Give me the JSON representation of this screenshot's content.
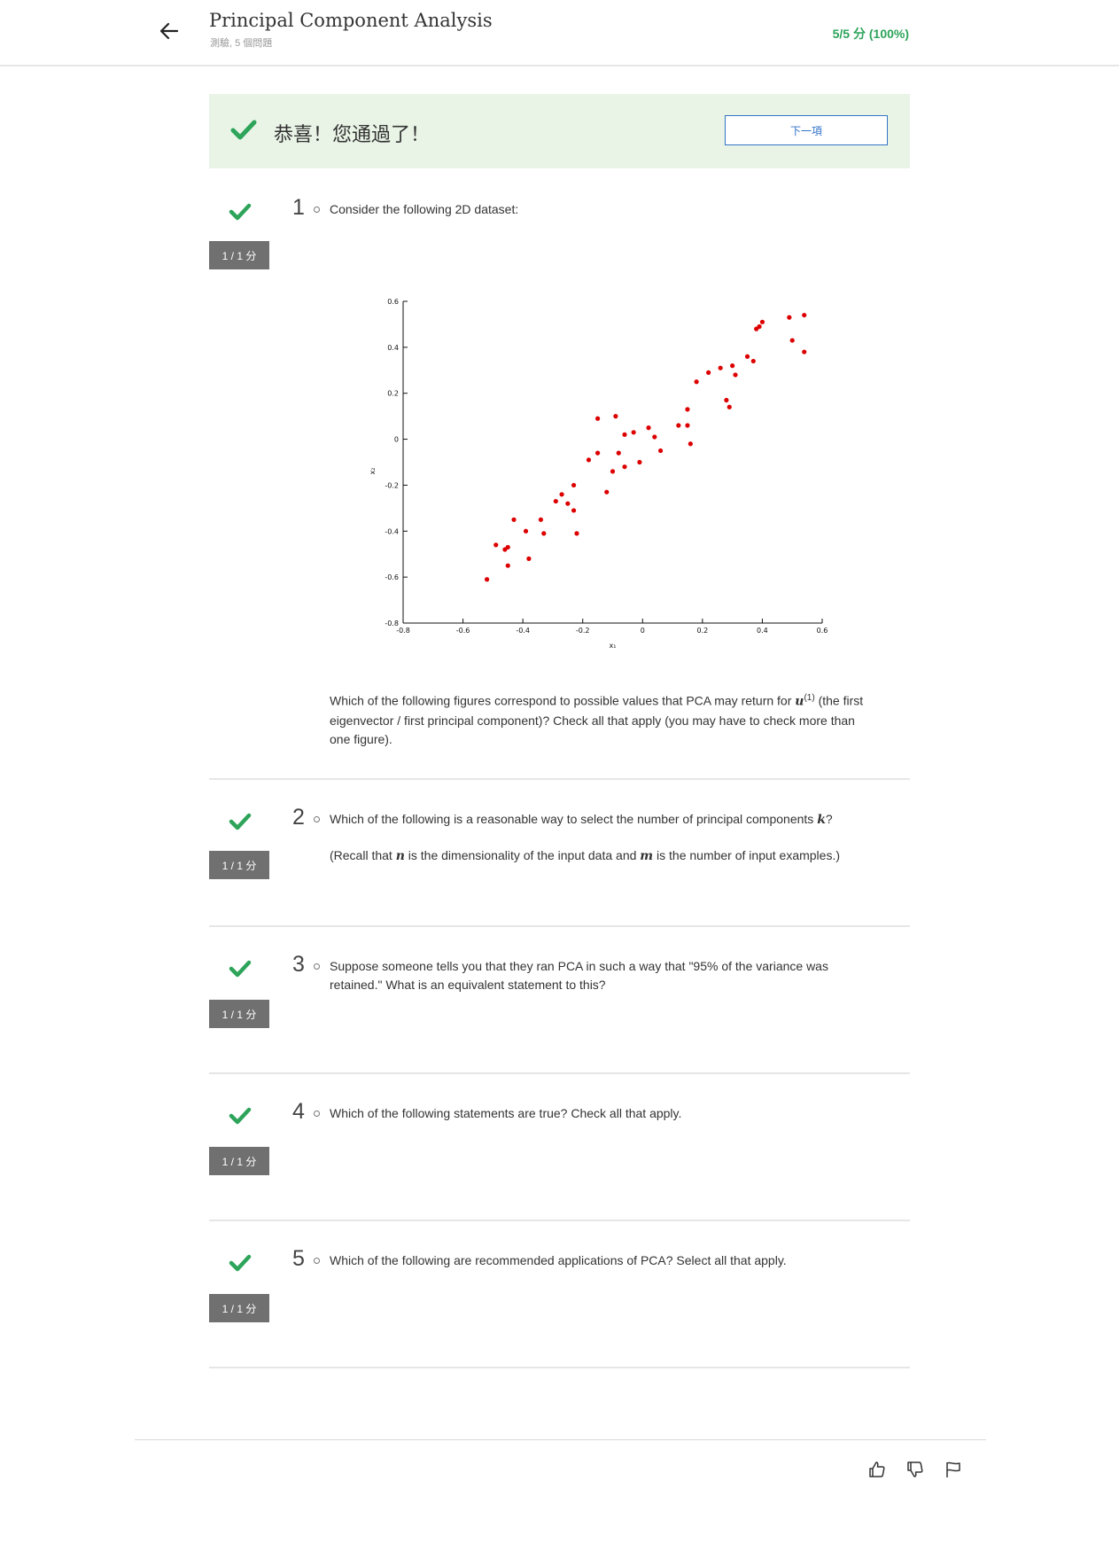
{
  "header": {
    "title": "Principal Component Analysis",
    "subtitle": "測驗, 5 個問題",
    "score": "5/5 分 (100%)"
  },
  "banner": {
    "message": "恭喜！您通過了！",
    "next_label": "下一項"
  },
  "questions": [
    {
      "number": "1",
      "badge": "1 / 1 分",
      "text": "Consider the following 2D dataset:",
      "followup_a": "Which of the following figures correspond to possible values that PCA may return for",
      "followup_math": "u",
      "followup_sup": "(1)",
      "followup_b": "(the first eigenvector / first principal component)? Check all that apply (you may have to check more than one figure)."
    },
    {
      "number": "2",
      "badge": "1 / 1 分",
      "text_a": "Which of the following is a reasonable way to select the number of principal components",
      "text_math": "k",
      "text_b": "?",
      "recall_a": "(Recall that",
      "recall_n": "n",
      "recall_b": "is the dimensionality of the input data and",
      "recall_m": "m",
      "recall_c": "is the number of input examples.)"
    },
    {
      "number": "3",
      "badge": "1 / 1 分",
      "text": "Suppose someone tells you that they ran PCA in such a way that \"95% of the variance was retained.\" What is an equivalent statement to this?"
    },
    {
      "number": "4",
      "badge": "1 / 1 分",
      "text": "Which of the following statements are true? Check all that apply."
    },
    {
      "number": "5",
      "badge": "1 / 1 分",
      "text": "Which of the following are recommended applications of PCA? Select all that apply."
    }
  ],
  "colors": {
    "accent_green": "#2da45a",
    "banner_bg": "#e9f4e6",
    "link_blue": "#3273c6",
    "point_red": "#dd0000"
  },
  "icons": [
    "back-arrow-icon",
    "checkmark-icon",
    "thumbs-up-icon",
    "thumbs-down-icon",
    "flag-icon"
  ],
  "chart_data": {
    "type": "scatter",
    "xlabel": "x₁",
    "ylabel": "x₂",
    "xlim": [
      -0.8,
      0.6
    ],
    "ylim": [
      -0.8,
      0.6
    ],
    "xticks": [
      "-0.8",
      "-0.6",
      "-0.4",
      "-0.2",
      "0",
      "0.2",
      "0.4",
      "0.6"
    ],
    "yticks": [
      "-0.8",
      "-0.6",
      "-0.4",
      "-0.2",
      "0",
      "0.2",
      "0.4",
      "0.6"
    ],
    "points": [
      [
        -0.52,
        -0.61
      ],
      [
        -0.49,
        -0.46
      ],
      [
        -0.46,
        -0.48
      ],
      [
        -0.45,
        -0.47
      ],
      [
        -0.45,
        -0.55
      ],
      [
        -0.43,
        -0.35
      ],
      [
        -0.39,
        -0.4
      ],
      [
        -0.38,
        -0.52
      ],
      [
        -0.34,
        -0.35
      ],
      [
        -0.33,
        -0.41
      ],
      [
        -0.29,
        -0.27
      ],
      [
        -0.27,
        -0.24
      ],
      [
        -0.25,
        -0.28
      ],
      [
        -0.23,
        -0.31
      ],
      [
        -0.23,
        -0.2
      ],
      [
        -0.22,
        -0.41
      ],
      [
        -0.18,
        -0.09
      ],
      [
        -0.15,
        -0.06
      ],
      [
        -0.15,
        0.09
      ],
      [
        -0.12,
        -0.23
      ],
      [
        -0.1,
        -0.14
      ],
      [
        -0.09,
        0.1
      ],
      [
        -0.08,
        -0.06
      ],
      [
        -0.06,
        0.02
      ],
      [
        -0.06,
        -0.12
      ],
      [
        -0.03,
        0.03
      ],
      [
        -0.01,
        -0.1
      ],
      [
        0.02,
        0.05
      ],
      [
        0.04,
        0.01
      ],
      [
        0.06,
        -0.05
      ],
      [
        0.12,
        0.06
      ],
      [
        0.15,
        0.06
      ],
      [
        0.15,
        0.13
      ],
      [
        0.16,
        -0.02
      ],
      [
        0.18,
        0.25
      ],
      [
        0.22,
        0.29
      ],
      [
        0.26,
        0.31
      ],
      [
        0.28,
        0.17
      ],
      [
        0.29,
        0.14
      ],
      [
        0.3,
        0.32
      ],
      [
        0.31,
        0.28
      ],
      [
        0.35,
        0.36
      ],
      [
        0.37,
        0.34
      ],
      [
        0.38,
        0.48
      ],
      [
        0.39,
        0.49
      ],
      [
        0.4,
        0.51
      ],
      [
        0.49,
        0.53
      ],
      [
        0.5,
        0.43
      ],
      [
        0.54,
        0.54
      ],
      [
        0.54,
        0.38
      ]
    ]
  }
}
